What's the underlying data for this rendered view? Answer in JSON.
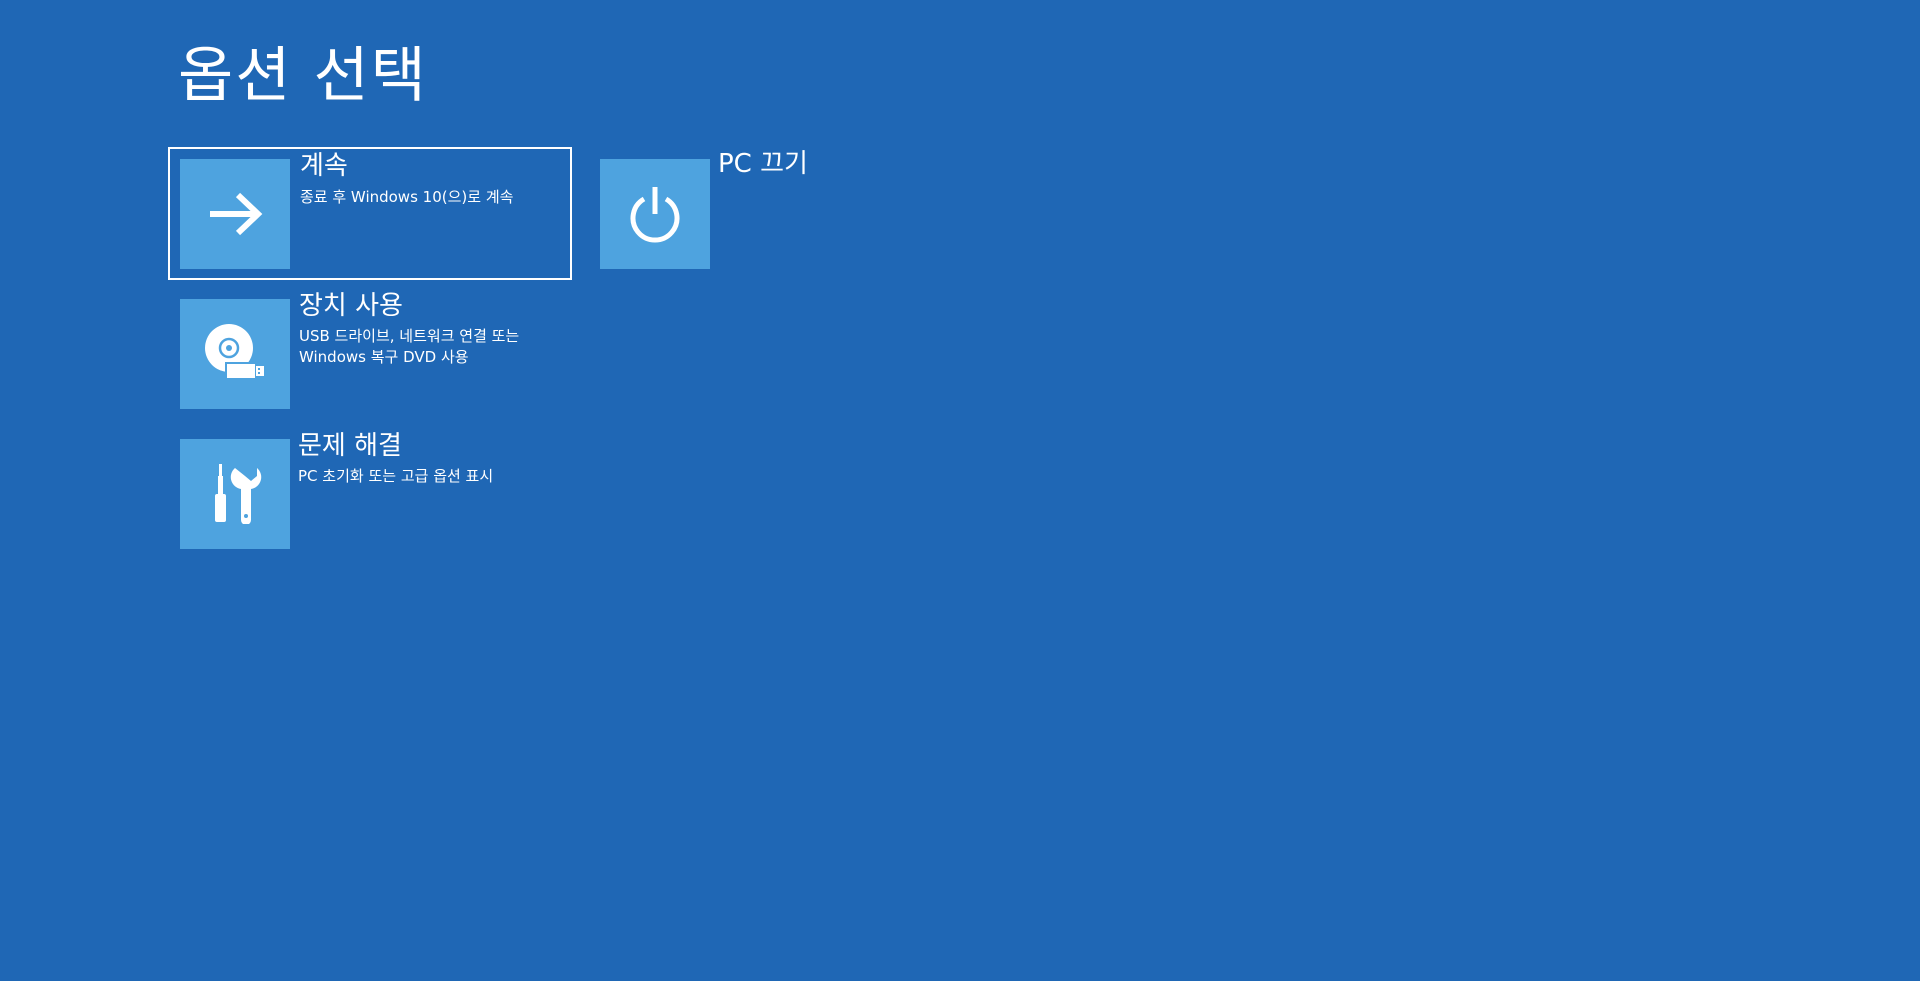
{
  "page": {
    "title": "옵션 선택",
    "background_color": "#1f67b5",
    "tile_color": "#4ea3df"
  },
  "options": [
    {
      "id": "continue",
      "title": "계속",
      "description_lines": [
        "종료 후 Windows 10(으)로 계속"
      ],
      "icon": "arrow-right-icon",
      "focused": true
    },
    {
      "id": "use-device",
      "title": "장치 사용",
      "description_lines": [
        "USB 드라이브, 네트워크 연결 또는",
        "Windows 복구 DVD 사용"
      ],
      "icon": "disc-usb-icon",
      "focused": false
    },
    {
      "id": "troubleshoot",
      "title": "문제 해결",
      "description_lines": [
        "PC 초기화 또는 고급 옵션 표시"
      ],
      "icon": "tools-icon",
      "focused": false
    },
    {
      "id": "turn-off",
      "title": "PC 끄기",
      "description_lines": [],
      "icon": "power-icon",
      "focused": false
    }
  ]
}
